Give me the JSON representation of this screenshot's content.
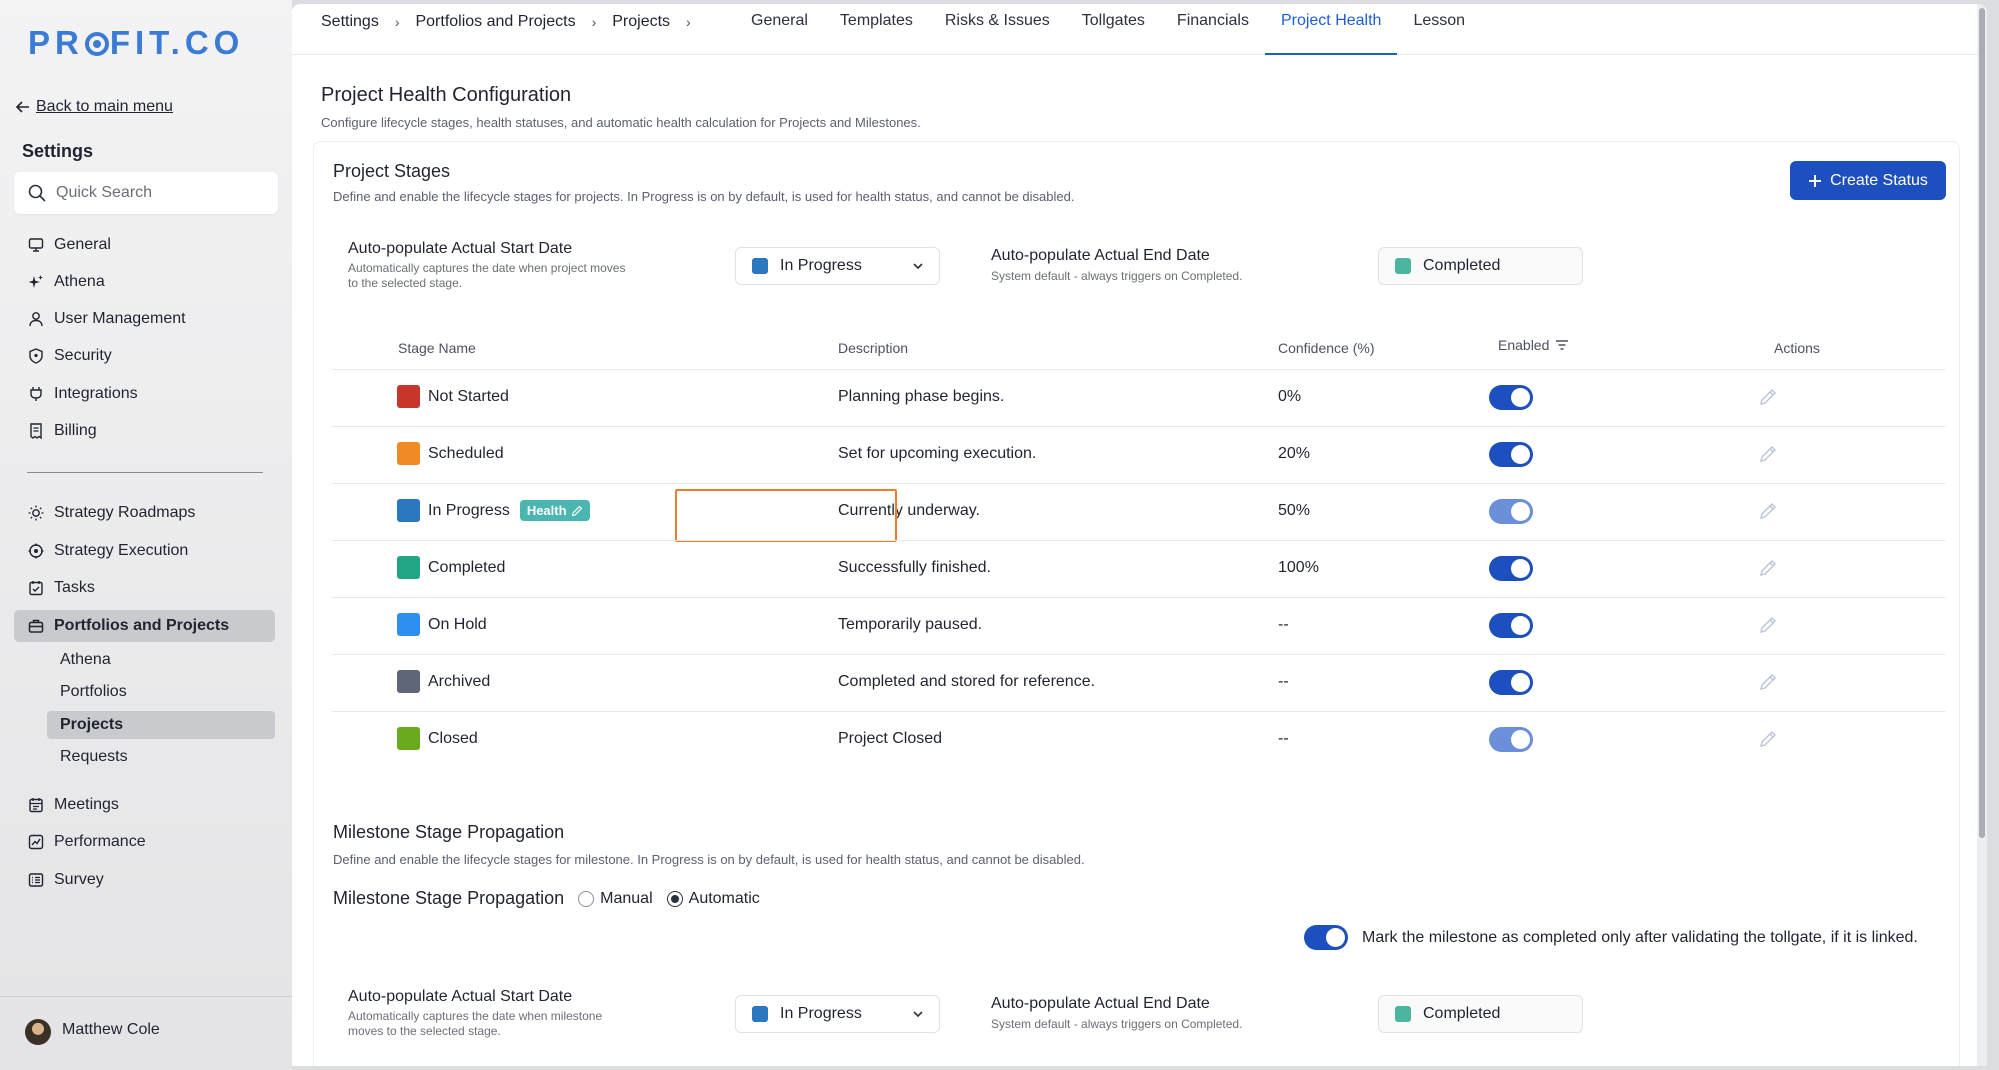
{
  "sidebar": {
    "logo": {
      "left": "PR",
      "right": "FIT.CO"
    },
    "back_label": "Back to main menu",
    "title": "Settings",
    "search_placeholder": "Quick Search",
    "items_top": [
      {
        "label": "General",
        "icon": "monitor-icon"
      },
      {
        "label": "Athena",
        "icon": "sparkle-icon"
      },
      {
        "label": "User Management",
        "icon": "user-icon"
      },
      {
        "label": "Security",
        "icon": "shield-icon"
      },
      {
        "label": "Integrations",
        "icon": "plug-icon"
      },
      {
        "label": "Billing",
        "icon": "receipt-icon"
      }
    ],
    "items_bottom": [
      {
        "label": "Strategy Roadmaps",
        "icon": "sun-icon"
      },
      {
        "label": "Strategy Execution",
        "icon": "target-icon"
      },
      {
        "label": "Tasks",
        "icon": "checklist-icon"
      },
      {
        "label": "Portfolios and Projects",
        "icon": "briefcase-icon",
        "active": true
      },
      {
        "label": "Meetings",
        "icon": "calendar-icon"
      },
      {
        "label": "Performance",
        "icon": "chart-icon"
      },
      {
        "label": "Survey",
        "icon": "survey-icon"
      }
    ],
    "sub_items": [
      {
        "label": "Athena"
      },
      {
        "label": "Portfolios"
      },
      {
        "label": "Projects",
        "active": true
      },
      {
        "label": "Requests"
      }
    ],
    "user_name": "Matthew Cole"
  },
  "breadcrumb": [
    "Settings",
    "Portfolios and Projects",
    "Projects"
  ],
  "tabs": [
    "General",
    "Templates",
    "Risks & Issues",
    "Tollgates",
    "Financials",
    "Project Health",
    "Lesson"
  ],
  "active_tab": "Project Health",
  "page": {
    "title": "Project Health Configuration",
    "subtitle": "Configure lifecycle stages, health statuses, and automatic health calculation for Projects and Milestones."
  },
  "project_stages": {
    "title": "Project Stages",
    "description": "Define and enable the lifecycle stages for projects. In Progress is on by default, is used for health status, and cannot be disabled.",
    "create_button": "Create Status",
    "start_label": "Auto-populate Actual Start Date",
    "start_hint_1": "Automatically captures the date when project moves",
    "start_hint_2": "to the selected stage.",
    "start_value": "In Progress",
    "end_label": "Auto-populate Actual End Date",
    "end_hint": "System default - always triggers on Completed.",
    "end_value": "Completed",
    "columns": {
      "name": "Stage Name",
      "description": "Description",
      "confidence": "Confidence (%)",
      "enabled": "Enabled",
      "actions": "Actions"
    },
    "health_badge": "Health",
    "rows": [
      {
        "name": "Not Started",
        "color": "#c8352b",
        "description": "Planning phase begins.",
        "confidence": "0%",
        "enabled": true
      },
      {
        "name": "Scheduled",
        "color": "#f08a25",
        "description": "Set for upcoming execution.",
        "confidence": "20%",
        "enabled": true
      },
      {
        "name": "In Progress",
        "color": "#2c78bf",
        "description": "Currently underway.",
        "confidence": "50%",
        "enabled": true,
        "locked": true
      },
      {
        "name": "Completed",
        "color": "#22a584",
        "description": "Successfully finished.",
        "confidence": "100%",
        "enabled": true
      },
      {
        "name": "On Hold",
        "color": "#2e8ff0",
        "description": "Temporarily paused.",
        "confidence": "--",
        "enabled": true
      },
      {
        "name": "Archived",
        "color": "#5e6677",
        "description": "Completed and stored for reference.",
        "confidence": "--",
        "enabled": true
      },
      {
        "name": "Closed",
        "color": "#6aaa1e",
        "description": "Project Closed",
        "confidence": "--",
        "enabled": true,
        "locked": true
      }
    ]
  },
  "milestone": {
    "title": "Milestone Stage Propagation",
    "description": "Define and enable the lifecycle stages for milestone. In Progress is on by default, is used for health status, and cannot be disabled.",
    "propagation_label": "Milestone Stage Propagation",
    "option_manual": "Manual",
    "option_automatic": "Automatic",
    "selected": "Automatic",
    "tollgate_text": "Mark the milestone as completed only after validating the tollgate, if it is linked.",
    "start_label": "Auto-populate Actual Start Date",
    "start_hint_1": "Automatically captures the date when milestone",
    "start_hint_2": "moves to the selected stage.",
    "start_value": "In Progress",
    "end_label": "Auto-populate Actual End Date",
    "end_hint": "System default - always triggers on Completed.",
    "end_value": "Completed"
  },
  "colors": {
    "accent": "#1d4fbf",
    "tab_active": "#1d5ed8",
    "health_badge": "#4bb5b2",
    "highlight": "#ef7b2d",
    "completed": "#4bb5a0",
    "in_progress": "#2c78bf"
  }
}
